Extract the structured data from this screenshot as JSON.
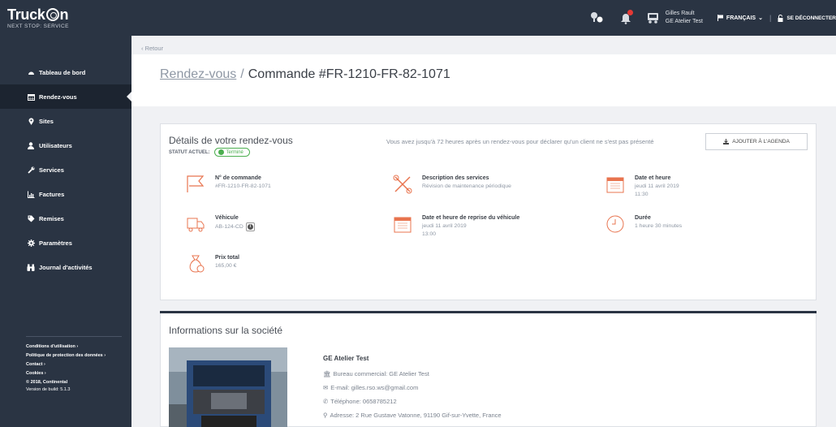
{
  "brand": {
    "name": "Truckon",
    "tagline": "NEXT STOP: SERVICE"
  },
  "topbar": {
    "user_name": "Gilles Rault",
    "user_company": "GE Atelier Test",
    "language": "FRANÇAIS",
    "logout": "SE DÉCONNECTER"
  },
  "sidebar": {
    "items": [
      {
        "label": "Tableau de bord",
        "icon": "dashboard-icon"
      },
      {
        "label": "Rendez-vous",
        "icon": "calendar-icon",
        "active": true
      },
      {
        "label": "Sites",
        "icon": "map-marker-icon"
      },
      {
        "label": "Utilisateurs",
        "icon": "user-icon"
      },
      {
        "label": "Services",
        "icon": "wrench-icon"
      },
      {
        "label": "Factures",
        "icon": "bar-chart-icon"
      },
      {
        "label": "Remises",
        "icon": "tag-icon"
      },
      {
        "label": "Paramètres",
        "icon": "gear-icon"
      },
      {
        "label": "Journal d'activités",
        "icon": "binoculars-icon"
      }
    ],
    "footer": {
      "links": [
        "Conditions d'utilisation",
        "Politique de protection des données",
        "Contact",
        "Cookies"
      ],
      "copyright": "2018, Continental",
      "version": "Version de build: 5.1.3"
    }
  },
  "main": {
    "back": "Retour",
    "breadcrumb": "Rendez-vous",
    "title": "Commande #FR-1210-FR-82-1071",
    "details": {
      "title": "Détails de votre rendez-vous",
      "status_label": "STATUT ACTUEL:",
      "status_value": "Terminé",
      "notice": "Vous avez jusqu'à 72 heures après un rendez-vous pour déclarer qu'un client ne s'est pas présenté",
      "agenda_button": "AJOUTER À L'AGENDA",
      "order_label": "N° de commande",
      "order_value": "#FR-1210-FR-82-1071",
      "services_label": "Description des services",
      "services_value": "Révision de maintenance périodique",
      "datetime_label": "Date et heure",
      "datetime_date": "jeudi 11 avril 2019",
      "datetime_time": "11:30",
      "vehicle_label": "Véhicule",
      "vehicle_value": "AB-124-CD",
      "pickup_label": "Date et heure de reprise du véhicule",
      "pickup_date": "jeudi 11 avril 2019",
      "pickup_time": "13:00",
      "duration_label": "Durée",
      "duration_value": "1 heure 30 minutes",
      "price_label": "Prix total",
      "price_value": "165,00 €"
    },
    "company": {
      "title": "Informations sur la société",
      "name": "GE Atelier Test",
      "office": "Bureau commercial: GE Atelier Test",
      "email": "E-mail: gilles.rso.ws@gmail.com",
      "phone": "Téléphone: 0658785212",
      "address": "Adresse: 2 Rue Gustave Vatonne, 91190 Gif-sur-Yvette, France"
    }
  },
  "colors": {
    "nav_bg": "#2a3443",
    "accent": "#e8744f",
    "success": "#4caf50"
  }
}
